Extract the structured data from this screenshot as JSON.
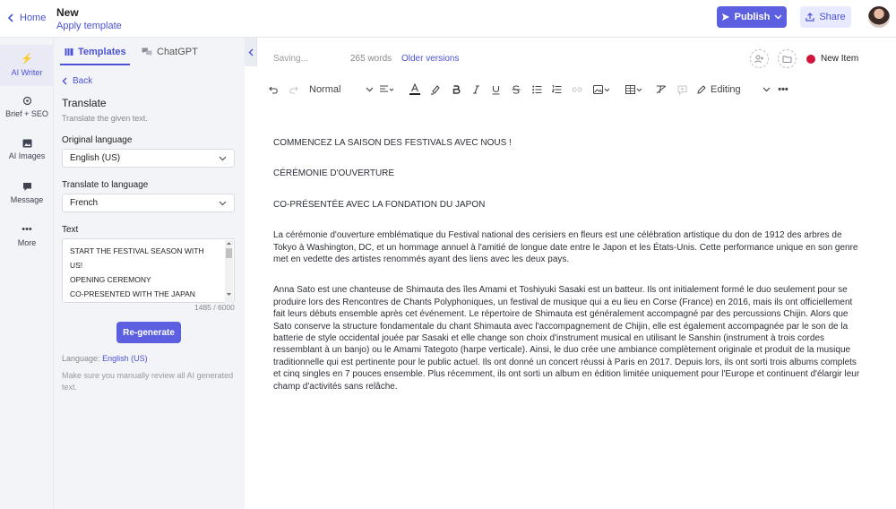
{
  "header": {
    "home_label": "Home",
    "doc_title": "New",
    "apply_template": "Apply template",
    "publish_label": "Publish",
    "share_label": "Share"
  },
  "rail": {
    "items": [
      {
        "label": "AI Writer",
        "icon": "lightning-icon"
      },
      {
        "label": "Brief + SEO",
        "icon": "target-icon"
      },
      {
        "label": "AI Images",
        "icon": "image-icon"
      },
      {
        "label": "Message",
        "icon": "chat-icon"
      },
      {
        "label": "More",
        "icon": "more-icon"
      }
    ]
  },
  "panel": {
    "tabs": {
      "templates": "Templates",
      "chatgpt": "ChatGPT"
    },
    "back_label": "Back",
    "tool_title": "Translate",
    "tool_description": "Translate the given text.",
    "original_language_label": "Original language",
    "original_language_value": "English (US)",
    "target_language_label": "Translate to language",
    "target_language_value": "French",
    "text_label": "Text",
    "text_lines": [
      "START THE FESTIVAL SEASON WITH",
      "US!",
      "OPENING CEREMONY",
      "CO-PRESENTED WITH THE JAPAN"
    ],
    "char_count": "1485 / 6000",
    "regenerate_label": "Re-generate",
    "language_prefix": "Language:",
    "language_value": "English (US)",
    "review_note": "Make sure you manually review all AI generated text."
  },
  "editor": {
    "status": {
      "saving": "Saving...",
      "words": "265 words",
      "older_versions": "Older versions",
      "item_label": "New Item",
      "item_color": "#d0143c"
    },
    "toolbar": {
      "style_value": "Normal",
      "mode_value": "Editing"
    },
    "content": {
      "lines": [
        "COMMENCEZ LA SAISON DES FESTIVALS AVEC NOUS !",
        "CÉRÉMONIE D'OUVERTURE",
        "CO-PRÉSENTÉE AVEC LA FONDATION DU JAPON"
      ],
      "paragraph1": "La cérémonie d'ouverture emblématique du Festival national des cerisiers en fleurs est une célébration artistique du don de 1912 des arbres de Tokyo à Washington, DC, et un hommage annuel à l'amitié de longue date entre le Japon et les États-Unis. Cette performance unique en son genre met en vedette des artistes renommés ayant des liens avec les deux pays.",
      "paragraph2": "Anna Sato est une chanteuse de Shimauta des îles Amami et Toshiyuki Sasaki est un batteur. Ils ont initialement formé le duo seulement pour se produire lors des Rencontres de Chants Polyphoniques, un festival de musique qui a eu lieu en Corse (France) en 2016, mais ils ont officiellement fait leurs débuts ensemble après cet événement. Le répertoire de Shimauta est généralement accompagné par des percussions Chijin. Alors que Sato conserve la structure fondamentale du chant Shimauta avec l'accompagnement de Chijin, elle est également accompagnée par le son de la batterie de style occidental jouée par Sasaki et elle change son choix d'instrument musical en utilisant le Sanshin (instrument à trois cordes ressemblant à un banjo) ou le Amami Tategoto (harpe verticale). Ainsi, le duo crée une ambiance complètement originale et produit de la musique traditionnelle qui est pertinente pour le public actuel. Ils ont donné un concert réussi à Paris en 2017. Depuis lors, ils ont sorti trois albums complets et cinq singles en 7 pouces ensemble. Plus récemment, ils ont sorti un album en édition limitée uniquement pour l'Europe et continuent d'élargir leur champ d'activités sans relâche."
    }
  },
  "colors": {
    "accent": "#5b5fe0",
    "link": "#4b52d6",
    "panel_bg": "#f3f4f7"
  }
}
